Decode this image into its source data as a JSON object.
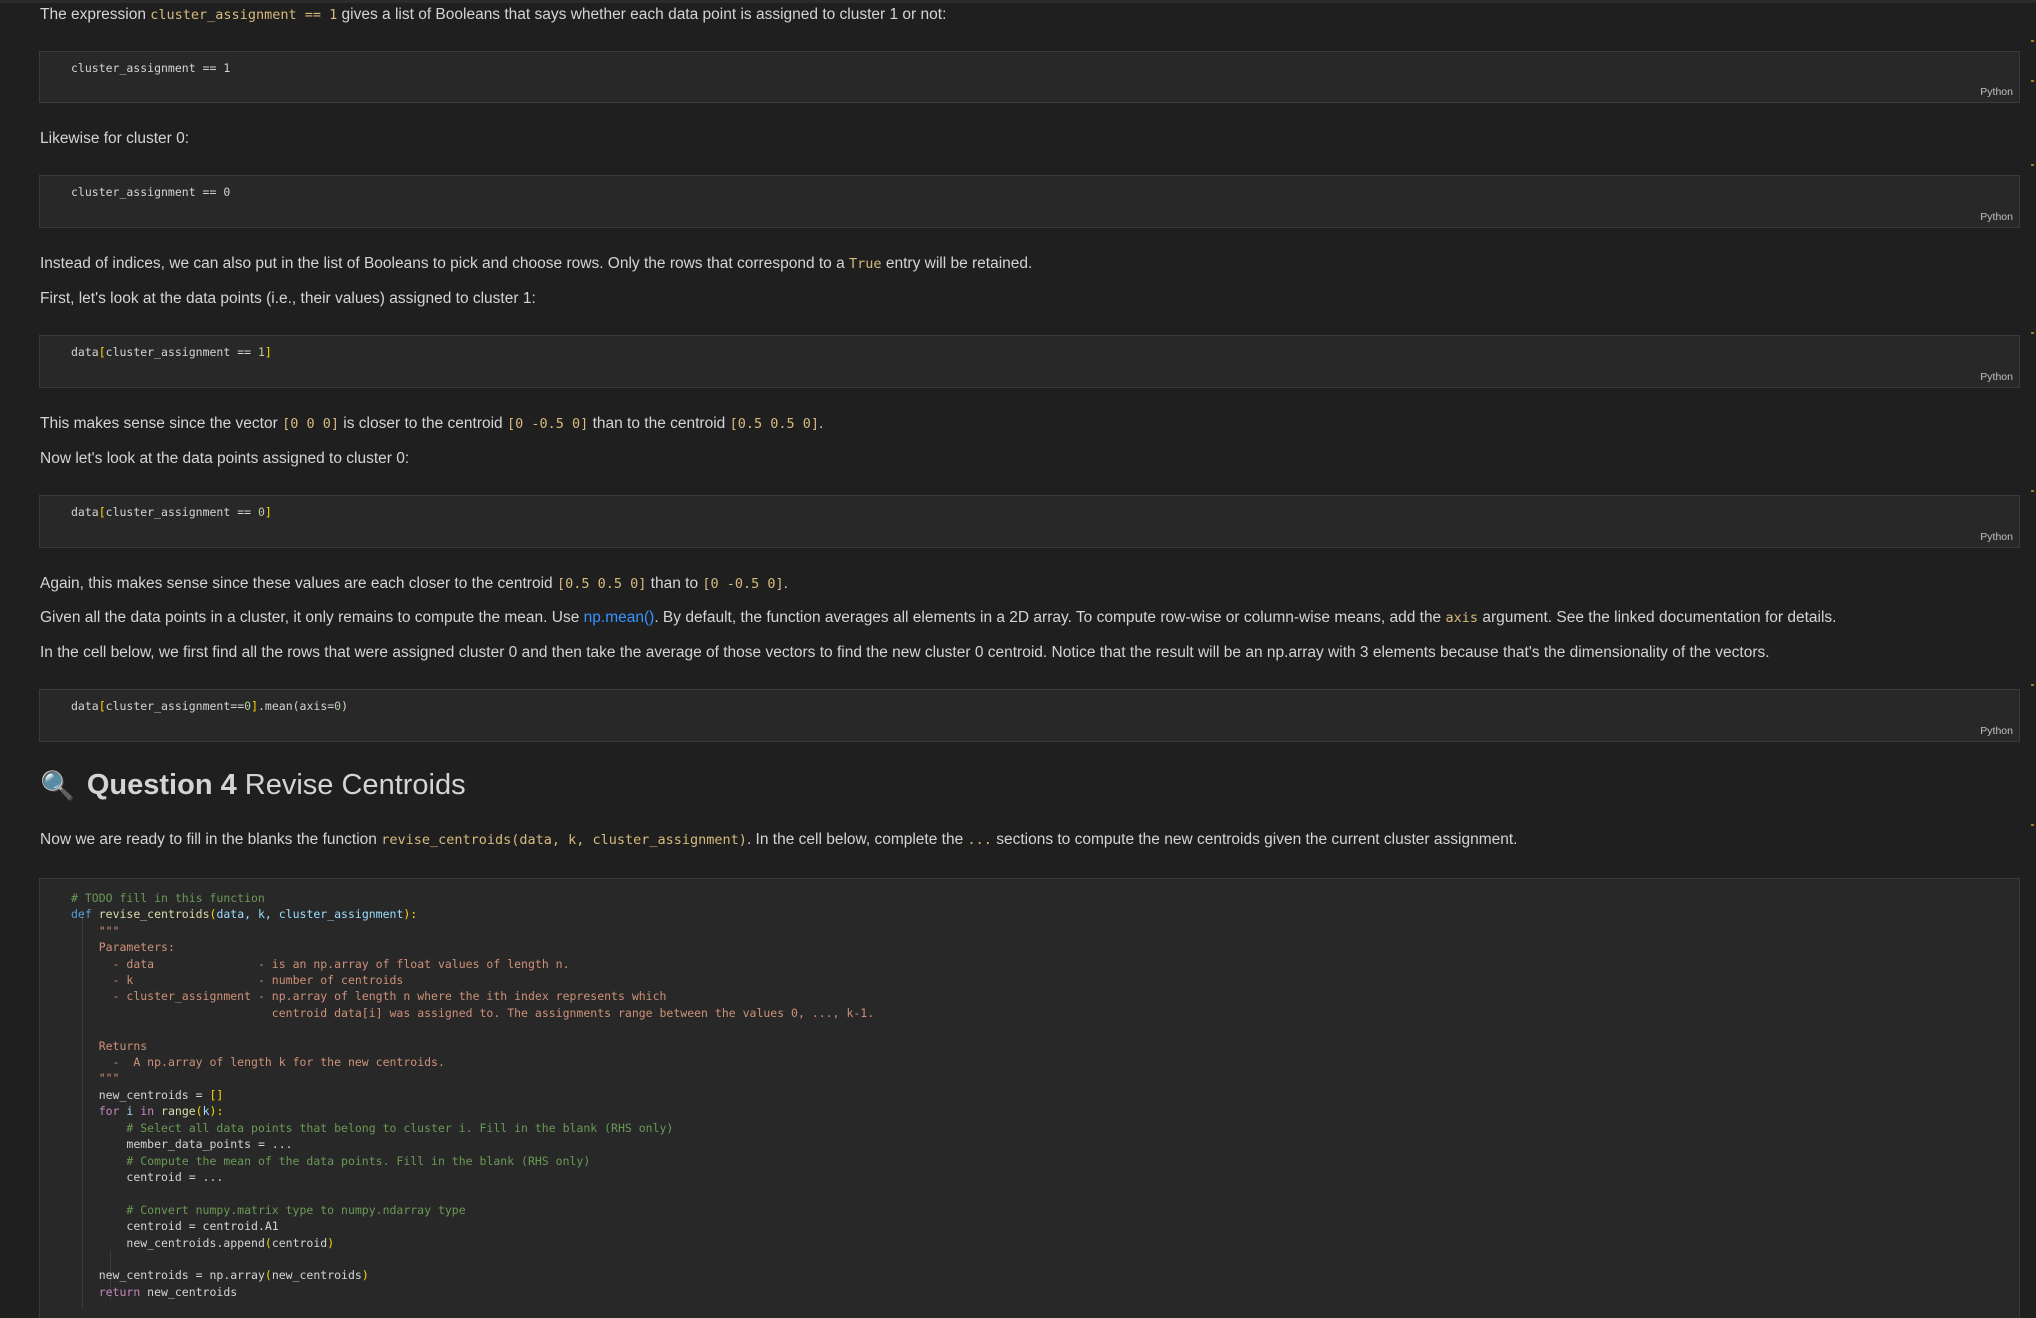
{
  "p1": {
    "a": "The expression ",
    "code": "cluster_assignment == 1",
    "b": " gives a list of Booleans that says whether each data point is assigned to cluster 1 or not:"
  },
  "cells": {
    "c1": {
      "code": "cluster_assignment == 1"
    },
    "c2": {
      "code": "cluster_assignment == 0"
    },
    "c3": {
      "a": "data",
      "b": "[",
      "c": "cluster_assignment == ",
      "d": "1",
      "e": "]"
    },
    "c4": {
      "a": "data",
      "b": "[",
      "c": "cluster_assignment == ",
      "d": "0",
      "e": "]"
    },
    "c5": {
      "a": "data",
      "b": "[",
      "c": "cluster_assignment==",
      "d": "0",
      "e": "]",
      "f": ".mean(",
      "g": "axis=",
      "h": "0",
      "i": ")"
    },
    "lang": "Python"
  },
  "p2": "Likewise for cluster 0:",
  "p3": {
    "a": "Instead of indices, we can also put in the list of Booleans to pick and choose rows. Only the rows that correspond to a ",
    "code": "True",
    "b": " entry will be retained."
  },
  "p4": "First, let's look at the data points (i.e., their values) assigned to cluster 1:",
  "p5": {
    "a": "This makes sense since the vector ",
    "c1": "[0 0 0]",
    "b": " is closer to the centroid ",
    "c2": "[0 -0.5 0]",
    "c": " than to the centroid ",
    "c3": "[0.5 0.5 0]",
    "d": "."
  },
  "p6": "Now let's look at the data points assigned to cluster 0:",
  "p7": {
    "a": "Again, this makes sense since these values are each closer to the centroid ",
    "c1": "[0.5 0.5 0]",
    "b": " than to ",
    "c2": "[0 -0.5 0]",
    "c": "."
  },
  "p8": {
    "a": "Given all the data points in a cluster, it only remains to compute the mean. Use ",
    "link": "np.mean()",
    "b": ". By default, the function averages all elements in a 2D array. To compute row-wise or column-wise means, add the ",
    "code": "axis",
    "c": " argument. See the linked documentation for details."
  },
  "p9": "In the cell below, we first find all the rows that were assigned cluster 0 and then take the average of those vectors to find the new cluster 0 centroid. Notice that the result will be an np.array with 3 elements because that's the dimensionality of the vectors.",
  "heading": {
    "icon": "🔍",
    "bold": "Question 4",
    "rest": " Revise Centroids"
  },
  "p10": {
    "a": "Now we are ready to fill in the blanks the function ",
    "code": "revise_centroids(data, k, cluster_assignment)",
    "b": ". In the cell below, complete the ",
    "code2": "...",
    "c": " sections to compute the new centroids given the current cluster assignment."
  },
  "big": {
    "l1": "# TODO fill in this function",
    "def": "def",
    "fname": "revise_centroids",
    "op": "(",
    "params": "data, k, cluster_assignment",
    "cp": "):",
    "doc": [
      "\"\"\"",
      "Parameters:",
      "  - data               - is an np.array of float values of length n.",
      "  - k                  - number of centroids",
      "  - cluster_assignment - np.array of length n where the ith index represents which",
      "                         centroid data[i] was assigned to. The assignments range between the values 0, ..., k-1.",
      "",
      "Returns",
      "  -  A np.array of length k for the new centroids.",
      "\"\"\""
    ],
    "nc": "new_centroids = ",
    "nc_b": "[]",
    "for": "for",
    "i": " i ",
    "in": "in",
    "range": " range",
    "rk_o": "(",
    "rk": "k",
    "rk_c": "):",
    "cm1": "# Select all data points that belong to cluster i. Fill in the blank (RHS only)",
    "mdp": "member_data_points = ...",
    "cm2": "# Compute the mean of the data points. Fill in the blank (RHS only)",
    "cen": "centroid = ...",
    "cm3": "# Convert numpy.matrix type to numpy.ndarray type",
    "a1": "centroid = centroid.A1",
    "app_a": "new_centroids.append",
    "app_o": "(",
    "app_v": "centroid",
    "app_c": ")",
    "arr_a": "new_centroids = np.array",
    "arr_o": "(",
    "arr_v": "new_centroids",
    "arr_c": ")",
    "ret": "return",
    "ret_v": " new_centroids"
  }
}
